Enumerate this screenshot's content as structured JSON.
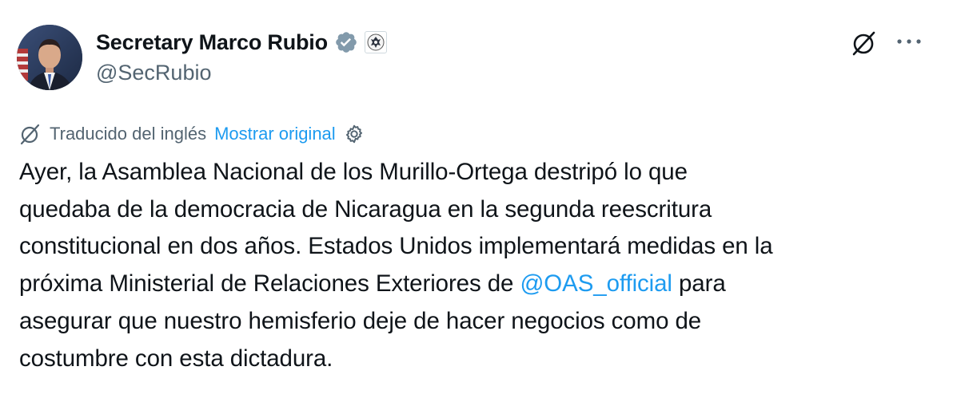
{
  "author": {
    "display_name": "Secretary Marco Rubio",
    "handle": "@SecRubio"
  },
  "translation": {
    "label": "Traducido del inglés",
    "show_original": "Mostrar original"
  },
  "text": {
    "line1": "Ayer, la Asamblea Nacional de los Murillo-Ortega destripó lo que",
    "line2": "quedaba de la democracia de Nicaragua en la segunda reescritura",
    "line3": "constitucional en dos años. Estados Unidos implementará medidas en la",
    "line4_before": "próxima Ministerial de Relaciones Exteriores de ",
    "line4_mention": "@OAS_official",
    "line4_after": " para",
    "line5": "asegurar que nuestro hemisferio deje de hacer negocios como de",
    "line6": "costumbre con esta dictadura."
  },
  "icons": {
    "verified": "verified-badge-icon",
    "gov_affiliation": "state-department-seal-icon",
    "grok": "grok-icon",
    "more": "more-options-icon",
    "translate": "translate-icon",
    "settings": "settings-gear-icon"
  },
  "colors": {
    "link": "#1d9bf0",
    "secondary_text": "#536471",
    "primary_text": "#0f1419",
    "verified_badge": "#829aab"
  }
}
